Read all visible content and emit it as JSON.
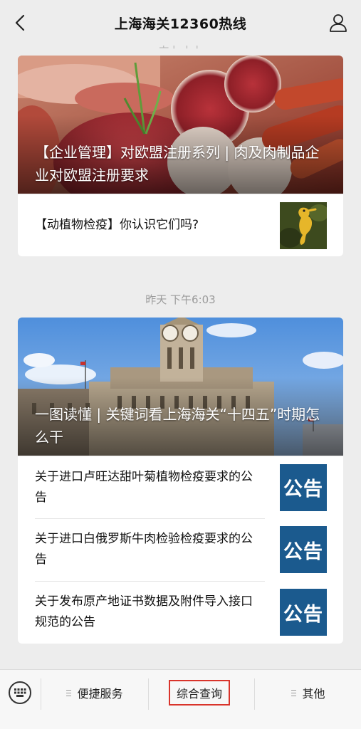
{
  "header": {
    "title": "上海海关12360热线",
    "back_icon": "chevron-left-icon",
    "profile_icon": "user-icon"
  },
  "feed": {
    "ghost_timestamp": "上午 下午",
    "group1": {
      "cover_title": "【企业管理】对欧盟注册系列 | 肉及肉制品企业对欧盟注册要求",
      "items": [
        {
          "title": "【动植物检疫】你认识它们吗?",
          "thumb": "seahorse-image"
        }
      ]
    },
    "timestamp2": "昨天 下午6:03",
    "group2": {
      "cover_title": "一图读懂 | 关键词看上海海关“十四五”时期怎么干",
      "items": [
        {
          "title": "关于进口卢旺达甜叶菊植物检疫要求的公告",
          "thumb_label": "公告"
        },
        {
          "title": "关于进口白俄罗斯牛肉检验检疫要求的公告",
          "thumb_label": "公告"
        },
        {
          "title": "关于发布原产地证书数据及附件导入接口规范的公告",
          "thumb_label": "公告"
        }
      ]
    }
  },
  "menu": {
    "keyboard_icon": "keyboard-icon",
    "items": [
      {
        "label": "便捷服务"
      },
      {
        "label": "综合查询"
      },
      {
        "label": "其他"
      }
    ]
  },
  "colors": {
    "notice_blue": "#1b5a8e",
    "highlight_red": "#d9342b",
    "background": "#ededed"
  }
}
